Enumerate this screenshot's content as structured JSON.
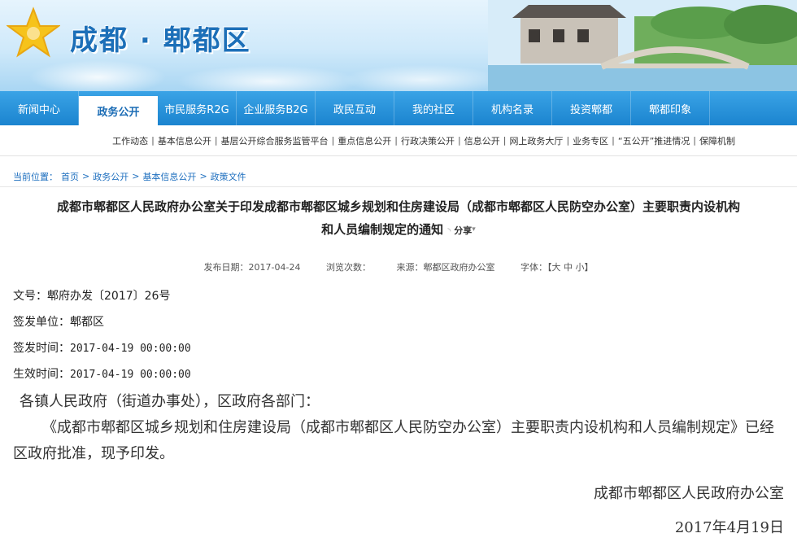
{
  "site": {
    "title": "成都 · 郫都区"
  },
  "main_nav": [
    {
      "label": "新闻中心"
    },
    {
      "label": "政务公开"
    },
    {
      "label": "市民服务R2G"
    },
    {
      "label": "企业服务B2G"
    },
    {
      "label": "政民互动"
    },
    {
      "label": "我的社区"
    },
    {
      "label": "机构名录"
    },
    {
      "label": "投资郫都"
    },
    {
      "label": "郫都印象"
    }
  ],
  "sub_nav": [
    {
      "label": "工作动态"
    },
    {
      "label": "基本信息公开"
    },
    {
      "label": "基层公开综合服务监管平台"
    },
    {
      "label": "重点信息公开"
    },
    {
      "label": "行政决策公开"
    },
    {
      "label": "信息公开"
    },
    {
      "label": "网上政务大厅"
    },
    {
      "label": "业务专区"
    },
    {
      "label": "“五公开”推进情况"
    },
    {
      "label": "保障机制"
    }
  ],
  "breadcrumb": {
    "prefix": "当前位置：",
    "items": [
      "首页",
      "政务公开",
      "基本信息公开",
      "政策文件"
    ],
    "separator": ">"
  },
  "article": {
    "title_line1": "成都市郫都区人民政府办公室关于印发成都市郫都区城乡规划和住房建设局（成都市郫都区人民防空办公室）主要职责内设机构",
    "title_line2": "和人员编制规定的通知",
    "share_label": "分享",
    "meta": {
      "publish_date": "发布日期：2017-04-24",
      "views": "浏览次数：",
      "source": "来源：郫都区政府办公室",
      "font_size": "字体：【大 中 小】"
    },
    "fields": {
      "doc_no_label": "文号：",
      "doc_no": "郫府办发〔2017〕26号",
      "issuer_label": "签发单位：",
      "issuer": "郫都区",
      "issue_time_label": "签发时间：",
      "issue_time": "2017-04-19 00:00:00",
      "effective_label": "生效时间：",
      "effective_time": "2017-04-19 00:00:00"
    },
    "greeting": "各镇人民政府（街道办事处），区政府各部门：",
    "body": "《成都市郫都区城乡规划和住房建设局（成都市郫都区人民防空办公室）主要职责内设机构和人员编制规定》已经区政府批准，现予印发。",
    "signer": "成都市郫都区人民政府办公室",
    "date": "2017年4月19日"
  },
  "colors": {
    "nav_blue": "#1b84cf",
    "title_blue": "#1c6fb8",
    "link_blue": "#1e6fbf"
  }
}
